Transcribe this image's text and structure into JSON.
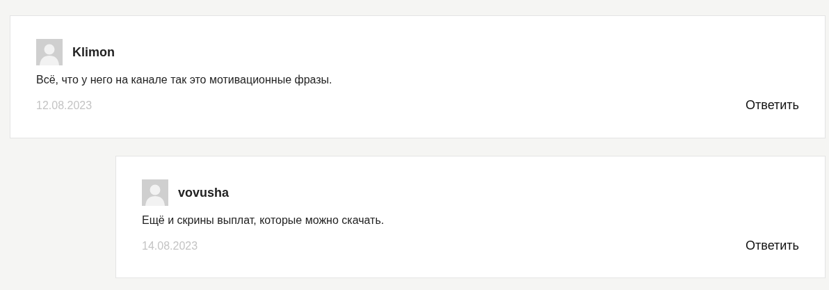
{
  "comments": [
    {
      "author": "Klimon",
      "text": "Всё, что у него на канале так это мотивационные фразы.",
      "date": "12.08.2023",
      "reply": "Ответить",
      "children": [
        {
          "author": "vovusha",
          "text": "Ещё и скрины выплат, которые можно скачать.",
          "date": "14.08.2023",
          "reply": "Ответить"
        }
      ]
    }
  ]
}
